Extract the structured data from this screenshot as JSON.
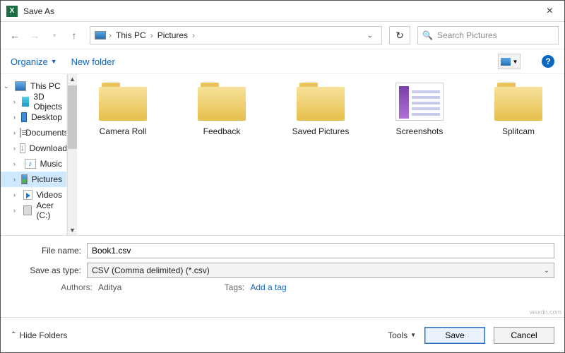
{
  "window": {
    "title": "Save As"
  },
  "nav": {
    "breadcrumb": [
      "This PC",
      "Pictures"
    ],
    "search_placeholder": "Search Pictures"
  },
  "toolbar": {
    "organize": "Organize",
    "new_folder": "New folder"
  },
  "tree": {
    "root": "This PC",
    "items": [
      {
        "label": "3D Objects",
        "icon": "obj3d"
      },
      {
        "label": "Desktop",
        "icon": "desktop"
      },
      {
        "label": "Documents",
        "icon": "docs"
      },
      {
        "label": "Downloads",
        "icon": "down"
      },
      {
        "label": "Music",
        "icon": "music"
      },
      {
        "label": "Pictures",
        "icon": "pics",
        "selected": true
      },
      {
        "label": "Videos",
        "icon": "vids"
      },
      {
        "label": "Acer (C:)",
        "icon": "drive"
      }
    ]
  },
  "files": [
    {
      "label": "Camera Roll",
      "kind": "folder"
    },
    {
      "label": "Feedback",
      "kind": "folder"
    },
    {
      "label": "Saved Pictures",
      "kind": "folder"
    },
    {
      "label": "Screenshots",
      "kind": "thumb"
    },
    {
      "label": "Splitcam",
      "kind": "folder"
    }
  ],
  "form": {
    "file_name_label": "File name:",
    "file_name_value": "Book1.csv",
    "save_as_type_label": "Save as type:",
    "save_as_type_value": "CSV (Comma delimited) (*.csv)",
    "authors_label": "Authors:",
    "authors_value": "Aditya",
    "tags_label": "Tags:",
    "tags_value": "Add a tag"
  },
  "footer": {
    "hide_folders": "Hide Folders",
    "tools": "Tools",
    "save": "Save",
    "cancel": "Cancel"
  },
  "watermark": "wsxdn.com"
}
